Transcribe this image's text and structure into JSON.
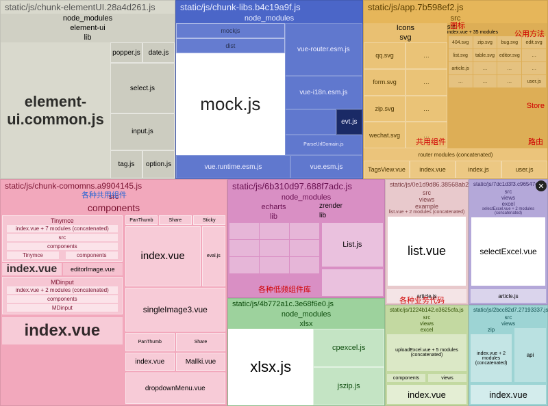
{
  "chunks": {
    "A": {
      "title": "static/js/chunk-elementUI.28a4d261.js",
      "levels": [
        "node_modules",
        "element-ui",
        "lib"
      ],
      "main": "element-ui.common.js",
      "side": [
        "popper.js",
        "date.js",
        "select.js",
        "input.js",
        "tag.js",
        "option.js"
      ]
    },
    "B": {
      "title": "static/js/chunk-libs.b4c19a9f.js",
      "levels": [
        "node_modules"
      ],
      "small": [
        "mockjs",
        "dist"
      ],
      "main": "mock.js",
      "right": [
        "vue-router.esm.js",
        "vue-i18n.esm.js",
        "evt.js"
      ],
      "bottom": [
        "vue.runtime.esm.js",
        "vue.esm.js"
      ]
    },
    "C": {
      "title": "static/js/app.7b598ef2.js",
      "levels": [
        "src"
      ],
      "icons_hdr": "Icons",
      "svg_hdr": "svg",
      "svgs": [
        "qq.svg",
        "form.svg",
        "zip.svg",
        "wechat.svg"
      ],
      "grid_hdr": "src",
      "grid_sub": "index.vue + 35 modules",
      "mini": [
        "404.svg",
        "zip.svg",
        "bug.svg",
        "edit.svg",
        "list.svg",
        "table.svg",
        "editor.svg",
        "article.js",
        "user.js"
      ],
      "bottom_wide": "router modules (concatenated)",
      "bottom_items": [
        "TagsView.vue",
        "index.vue",
        "index.js",
        "user.js"
      ],
      "annots": {
        "a1": "图标",
        "a2": "公用方法",
        "a3": "Store",
        "a4": "共用组件",
        "a5": "路由"
      }
    },
    "D": {
      "title": "static/js/chunk-comomns.a9904145.js",
      "annot": "各种共用组件",
      "levels": [
        "src",
        "components"
      ],
      "tinymce": {
        "hdr": "Tinymce",
        "line": "index.vue + 7 modules (concatenated)",
        "sub": [
          "src",
          "components",
          "Tinymce",
          "components"
        ]
      },
      "dual_main": "index.vue",
      "dual_side": "editorImage.vue",
      "mdinput": {
        "hdr": "MDinput",
        "line": "index.vue + 2 modules (concatenated)",
        "sub": [
          "components",
          "MDinput"
        ]
      },
      "big": "index.vue",
      "right_items": [
        "index.vue",
        "singleImage3.vue",
        "index.vue",
        "Mallki.vue",
        "dropdownMenu.vue"
      ],
      "right_tiny": [
        "PanThumb",
        "Share",
        "Sticky"
      ]
    },
    "E1": {
      "title": "static/js/6b310d97.688f7adc.js",
      "levels": [
        "node_modules",
        "echarts",
        "lib"
      ],
      "zr": "zrender",
      "zr_sub": "lib",
      "list": "List.js",
      "annot": "各种低频组件库"
    },
    "E2": {
      "title": "static/js/4b772a1c.3e68f6e0.js",
      "levels": [
        "node_modules",
        "xlsx"
      ],
      "main": "xlsx.js",
      "right": [
        "cpexcel.js",
        "jszip.js"
      ]
    },
    "F1": {
      "title": "static/js/0e1d9d86.38568ab2.js",
      "stack": [
        "src",
        "views",
        "example",
        "list.vue + 2 modules (concatenated)"
      ],
      "main": "list.vue",
      "art": "article.js",
      "annot": "各种业务代码"
    },
    "F2": {
      "title": "static/js/1224b142.e3625cfa.js",
      "stack": [
        "src",
        "views",
        "excel"
      ],
      "mid": "uploadExcel.vue + 5 modules (concatenated)",
      "sub": [
        "components",
        "views"
      ],
      "main": "index.vue"
    },
    "G1": {
      "title": "static/js/7dc1d3f3.c96547ee.js",
      "stack": [
        "src",
        "views",
        "excel",
        "selectExcel.vue + 2 modules (concatenated)"
      ],
      "main": "selectExcel.vue",
      "art": "article.js"
    },
    "G2": {
      "title": "static/js/2bcc82d7.27193337.js",
      "stack": [
        "src",
        "views",
        "zip"
      ],
      "mid": "index.vue + 2 modules (concatenated)",
      "api": "api",
      "main": "index.vue"
    }
  },
  "close": "✕"
}
